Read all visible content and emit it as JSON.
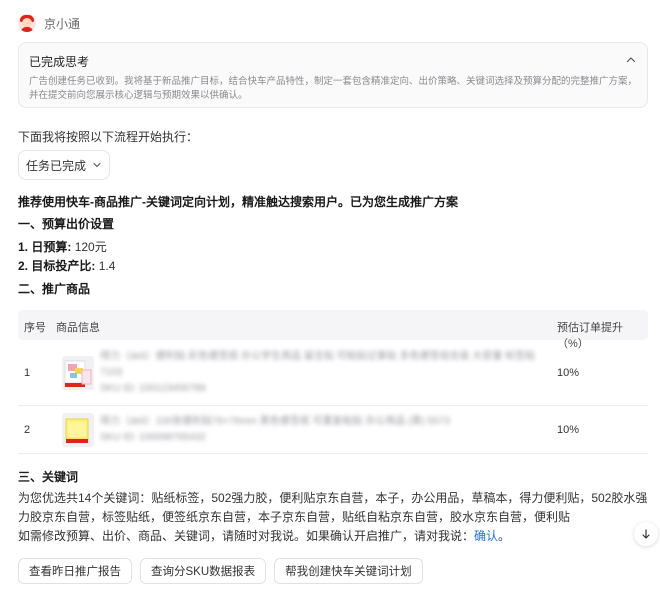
{
  "assistant": {
    "name": "京小通"
  },
  "think": {
    "title": "已完成思考",
    "body": "广告创建任务已收到。我将基于新品推广目标，结合快车产品特性，制定一套包含精准定向、出价策略、关键词选择及预算分配的完整推广方案，并在提交前向您展示核心逻辑与预期效果以供确认。"
  },
  "intro": "下面我将按照以下流程开始执行：",
  "task_button": {
    "label": "任务已完成"
  },
  "recommendation": "推荐使用快车-商品推广-关键词定向计划，精准触达搜索用户。已为您生成推广方案",
  "budget": {
    "title": "一、预算出价设置",
    "daily_label": "1. 日预算:",
    "daily_value": "120元",
    "roi_label": "2. 目标投产比:",
    "roi_value": "1.4"
  },
  "products": {
    "title": "二、推广商品",
    "headers": {
      "index": "序号",
      "info": "商品信息",
      "lift": "预估订单提升（%）"
    },
    "rows": [
      {
        "index": "1",
        "lift": "10%",
        "blur1": "得力（deli）便利贴 彩色便签纸 办公学生用品 留言贴 可粘贴记事贴 多色便签组合装 大容量 标签贴",
        "blur2": "7103",
        "blur3": "SKU ID: 100123456789"
      },
      {
        "index": "2",
        "lift": "10%",
        "blur1": "得力（deli）100张便利贴76×76mm 黄色便签纸 可重复粘贴 办公用品 (黄) 5573",
        "blur2": "SKU ID: 100098765432"
      }
    ]
  },
  "keywords": {
    "title": "三、关键词",
    "body": "为您优选共14个关键词：贴纸标签，502强力胶，便利贴京东自营，本子，办公用品，草稿本，得力便利贴，502胶水强力胶京东自营，标签贴纸，便签纸京东自营，本子京东自营，贴纸自粘京东自营，胶水京东自营，便利贴",
    "confirm_text": "如需修改预算、出价、商品、关键词，请随时对我说。如果确认开启推广，请对我说：",
    "confirm_link": "确认",
    "confirm_end": "。"
  },
  "actions": [
    {
      "label": "查看昨日推广报告"
    },
    {
      "label": "查询分SKU数据报表"
    },
    {
      "label": "帮我创建快车关键词计划"
    }
  ],
  "colors": {
    "link": "#1e6fe8",
    "brand_red": "#e2231a"
  },
  "icons": {
    "think_toggle": "chevron-up-icon",
    "task_toggle": "chevron-down-icon",
    "scroll": "arrow-down-icon"
  }
}
